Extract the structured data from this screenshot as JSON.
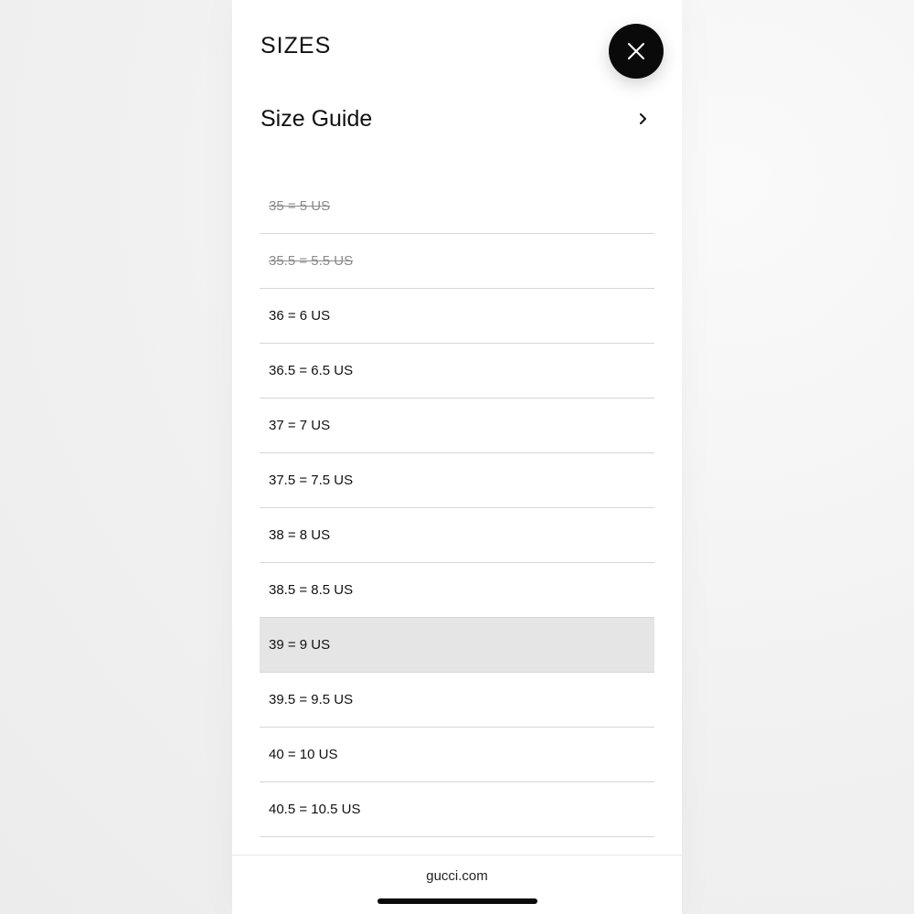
{
  "sheet": {
    "title": "SIZES",
    "size_guide_label": "Size Guide"
  },
  "icons": {
    "close": "close-icon",
    "size_guide_arrow": "chevron-right-icon"
  },
  "sizes": [
    {
      "label": "35 = 5 US",
      "available": false,
      "selected": false
    },
    {
      "label": "35.5 = 5.5 US",
      "available": false,
      "selected": false
    },
    {
      "label": "36 = 6 US",
      "available": true,
      "selected": false
    },
    {
      "label": "36.5 = 6.5 US",
      "available": true,
      "selected": false
    },
    {
      "label": "37 = 7 US",
      "available": true,
      "selected": false
    },
    {
      "label": "37.5 = 7.5 US",
      "available": true,
      "selected": false
    },
    {
      "label": "38 = 8 US",
      "available": true,
      "selected": false
    },
    {
      "label": "38.5 = 8.5 US",
      "available": true,
      "selected": false
    },
    {
      "label": "39 = 9 US",
      "available": true,
      "selected": true
    },
    {
      "label": "39.5 = 9.5 US",
      "available": true,
      "selected": false
    },
    {
      "label": "40 = 10 US",
      "available": true,
      "selected": false
    },
    {
      "label": "40.5 = 10.5 US",
      "available": true,
      "selected": false
    }
  ],
  "footer": {
    "domain": "gucci.com"
  },
  "colors": {
    "selected_row": "#e5e5e5",
    "unavailable_text": "#8a8a8a",
    "close_button": "#0a0a0a"
  }
}
